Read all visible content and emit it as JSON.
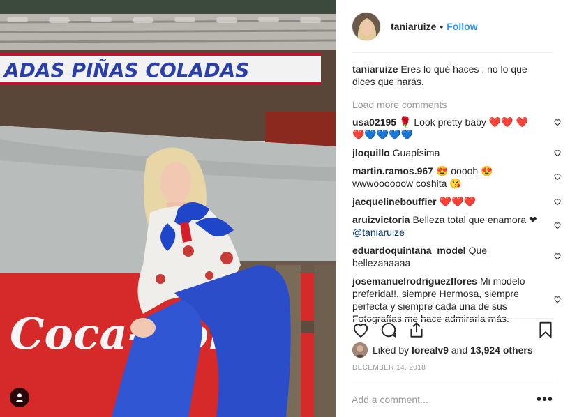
{
  "photo": {
    "sign_text": "ADAS  PIÑAS COLADAS",
    "brand_text": "Coca-Cola",
    "user_tag_icon": "person-icon"
  },
  "post": {
    "username": "taniaruize",
    "follow_label": "Follow",
    "caption": "Eres lo qué haces , no lo que dices que harás.",
    "load_more_label": "Load more comments",
    "comments": [
      {
        "user": "usa02195",
        "text": "🌹 Look pretty baby ❤️❤️ ❤️❤️💙💙💙💙"
      },
      {
        "user": "jloquillo",
        "text": "Guapísima"
      },
      {
        "user": "martin.ramos.967",
        "text": "😍 ooooh 😍 wwwoooooow coshita 😘"
      },
      {
        "user": "jacquelinebouffier",
        "text": "❤️❤️❤️"
      },
      {
        "user": "aruizvictoria",
        "text": "Belleza total que enamora ❤",
        "mention": "@taniaruize"
      },
      {
        "user": "eduardoquintana_model",
        "text": "Que bellezaaaaaa"
      },
      {
        "user": "josemanuelrodriguezflores",
        "text": "Mi modelo preferida!!, siempre Hermosa, siempre perfecta y siempre cada una de sus Fotografías me hace admirarla más."
      }
    ],
    "likes": {
      "prefix": "Liked by",
      "liker": "lorealv9",
      "and": "and",
      "count": "13,924 others"
    },
    "date": "DECEMBER 14, 2018",
    "add_comment_placeholder": "Add a comment...",
    "more_options_label": "•••"
  },
  "colors": {
    "link_blue": "#3897f0",
    "muted": "#999999",
    "text": "#262626",
    "border": "#efefef"
  }
}
